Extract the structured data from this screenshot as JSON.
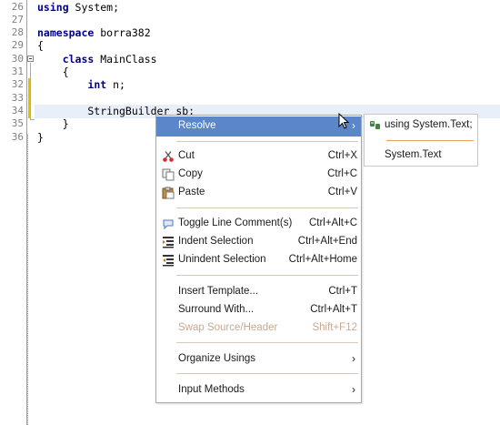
{
  "editor": {
    "line_numbers": [
      "26",
      "27",
      "28",
      "29",
      "30",
      "31",
      "32",
      "33",
      "34",
      "35",
      "36"
    ],
    "lines": [
      {
        "kw": "using",
        "rest": " System;"
      },
      {
        "kw": "",
        "rest": ""
      },
      {
        "kw": "namespace",
        "rest": " borra382"
      },
      {
        "kw": "",
        "rest": "{"
      },
      {
        "kw": "class",
        "rest": " MainClass",
        "indent": "    "
      },
      {
        "kw": "",
        "rest": "    {"
      },
      {
        "kw": "int",
        "rest": " n;",
        "indent": "        "
      },
      {
        "kw": "",
        "rest": ""
      },
      {
        "kw": "",
        "rest": "        StringBuilder sb;"
      },
      {
        "kw": "",
        "rest": "    }"
      },
      {
        "kw": "",
        "rest": "}"
      }
    ]
  },
  "context_menu": {
    "resolve": "Resolve",
    "items": [
      {
        "label": "Cut",
        "shortcut": "Ctrl+X",
        "icon": "scissors-icon"
      },
      {
        "label": "Copy",
        "shortcut": "Ctrl+C",
        "icon": "copy-icon"
      },
      {
        "label": "Paste",
        "shortcut": "Ctrl+V",
        "icon": "paste-icon"
      },
      {
        "label": "Toggle Line Comment(s)",
        "shortcut": "Ctrl+Alt+C",
        "icon": "comment-icon"
      },
      {
        "label": "Indent Selection",
        "shortcut": "Ctrl+Alt+End",
        "icon": "indent-icon"
      },
      {
        "label": "Unindent Selection",
        "shortcut": "Ctrl+Alt+Home",
        "icon": "unindent-icon"
      },
      {
        "label": "Insert Template...",
        "shortcut": "Ctrl+T"
      },
      {
        "label": "Surround With...",
        "shortcut": "Ctrl+Alt+T"
      },
      {
        "label": "Swap Source/Header",
        "shortcut": "Shift+F12",
        "disabled": true
      },
      {
        "label": "Organize Usings",
        "submenu": true
      },
      {
        "label": "Input Methods",
        "submenu": true
      }
    ]
  },
  "submenu": {
    "items": [
      "using System.Text;",
      "System.Text"
    ]
  },
  "colors": {
    "menu_highlight": "#5b86c9",
    "keyword": "#00008b",
    "change_marker": "#e6c000"
  }
}
